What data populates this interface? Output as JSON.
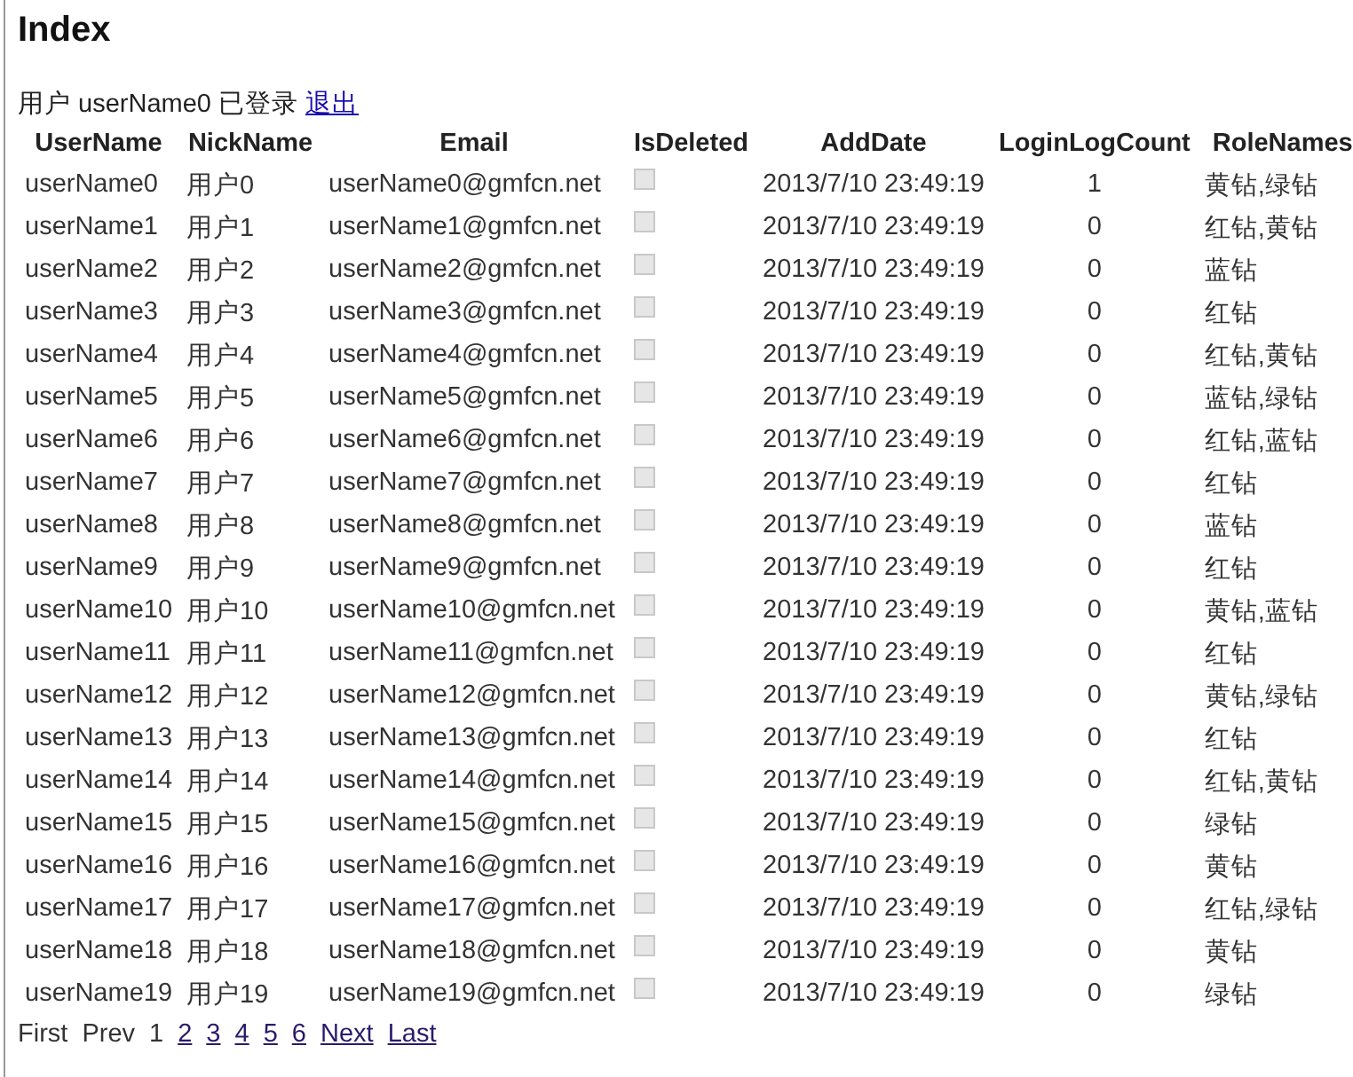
{
  "heading": "Index",
  "login": {
    "text": "用户 userName0 已登录",
    "logout_link": "退出"
  },
  "table": {
    "columns": [
      "UserName",
      "NickName",
      "Email",
      "IsDeleted",
      "AddDate",
      "LoginLogCount",
      "RoleNames"
    ],
    "rows": [
      {
        "username": "userName0",
        "nickname": "用户0",
        "email": "userName0@gmfcn.net",
        "is_deleted": {
          "checked": false,
          "disabled": true
        },
        "add_date": "2013/7/10 23:49:19",
        "login_log_count": "1",
        "role_names": "黄钻,绿钻"
      },
      {
        "username": "userName1",
        "nickname": "用户1",
        "email": "userName1@gmfcn.net",
        "is_deleted": {
          "checked": false,
          "disabled": true
        },
        "add_date": "2013/7/10 23:49:19",
        "login_log_count": "0",
        "role_names": "红钻,黄钻"
      },
      {
        "username": "userName2",
        "nickname": "用户2",
        "email": "userName2@gmfcn.net",
        "is_deleted": {
          "checked": false,
          "disabled": true
        },
        "add_date": "2013/7/10 23:49:19",
        "login_log_count": "0",
        "role_names": "蓝钻"
      },
      {
        "username": "userName3",
        "nickname": "用户3",
        "email": "userName3@gmfcn.net",
        "is_deleted": {
          "checked": false,
          "disabled": true
        },
        "add_date": "2013/7/10 23:49:19",
        "login_log_count": "0",
        "role_names": "红钻"
      },
      {
        "username": "userName4",
        "nickname": "用户4",
        "email": "userName4@gmfcn.net",
        "is_deleted": {
          "checked": false,
          "disabled": true
        },
        "add_date": "2013/7/10 23:49:19",
        "login_log_count": "0",
        "role_names": "红钻,黄钻"
      },
      {
        "username": "userName5",
        "nickname": "用户5",
        "email": "userName5@gmfcn.net",
        "is_deleted": {
          "checked": false,
          "disabled": true
        },
        "add_date": "2013/7/10 23:49:19",
        "login_log_count": "0",
        "role_names": "蓝钻,绿钻"
      },
      {
        "username": "userName6",
        "nickname": "用户6",
        "email": "userName6@gmfcn.net",
        "is_deleted": {
          "checked": false,
          "disabled": true
        },
        "add_date": "2013/7/10 23:49:19",
        "login_log_count": "0",
        "role_names": "红钻,蓝钻"
      },
      {
        "username": "userName7",
        "nickname": "用户7",
        "email": "userName7@gmfcn.net",
        "is_deleted": {
          "checked": false,
          "disabled": true
        },
        "add_date": "2013/7/10 23:49:19",
        "login_log_count": "0",
        "role_names": "红钻"
      },
      {
        "username": "userName8",
        "nickname": "用户8",
        "email": "userName8@gmfcn.net",
        "is_deleted": {
          "checked": false,
          "disabled": true
        },
        "add_date": "2013/7/10 23:49:19",
        "login_log_count": "0",
        "role_names": "蓝钻"
      },
      {
        "username": "userName9",
        "nickname": "用户9",
        "email": "userName9@gmfcn.net",
        "is_deleted": {
          "checked": false,
          "disabled": true
        },
        "add_date": "2013/7/10 23:49:19",
        "login_log_count": "0",
        "role_names": "红钻"
      },
      {
        "username": "userName10",
        "nickname": "用户10",
        "email": "userName10@gmfcn.net",
        "is_deleted": {
          "checked": false,
          "disabled": true
        },
        "add_date": "2013/7/10 23:49:19",
        "login_log_count": "0",
        "role_names": "黄钻,蓝钻"
      },
      {
        "username": "userName11",
        "nickname": "用户11",
        "email": "userName11@gmfcn.net",
        "is_deleted": {
          "checked": false,
          "disabled": true
        },
        "add_date": "2013/7/10 23:49:19",
        "login_log_count": "0",
        "role_names": "红钻"
      },
      {
        "username": "userName12",
        "nickname": "用户12",
        "email": "userName12@gmfcn.net",
        "is_deleted": {
          "checked": false,
          "disabled": true
        },
        "add_date": "2013/7/10 23:49:19",
        "login_log_count": "0",
        "role_names": "黄钻,绿钻"
      },
      {
        "username": "userName13",
        "nickname": "用户13",
        "email": "userName13@gmfcn.net",
        "is_deleted": {
          "checked": false,
          "disabled": true
        },
        "add_date": "2013/7/10 23:49:19",
        "login_log_count": "0",
        "role_names": "红钻"
      },
      {
        "username": "userName14",
        "nickname": "用户14",
        "email": "userName14@gmfcn.net",
        "is_deleted": {
          "checked": false,
          "disabled": true
        },
        "add_date": "2013/7/10 23:49:19",
        "login_log_count": "0",
        "role_names": "红钻,黄钻"
      },
      {
        "username": "userName15",
        "nickname": "用户15",
        "email": "userName15@gmfcn.net",
        "is_deleted": {
          "checked": false,
          "disabled": true
        },
        "add_date": "2013/7/10 23:49:19",
        "login_log_count": "0",
        "role_names": "绿钻"
      },
      {
        "username": "userName16",
        "nickname": "用户16",
        "email": "userName16@gmfcn.net",
        "is_deleted": {
          "checked": false,
          "disabled": true
        },
        "add_date": "2013/7/10 23:49:19",
        "login_log_count": "0",
        "role_names": "黄钻"
      },
      {
        "username": "userName17",
        "nickname": "用户17",
        "email": "userName17@gmfcn.net",
        "is_deleted": {
          "checked": false,
          "disabled": true
        },
        "add_date": "2013/7/10 23:49:19",
        "login_log_count": "0",
        "role_names": "红钻,绿钻"
      },
      {
        "username": "userName18",
        "nickname": "用户18",
        "email": "userName18@gmfcn.net",
        "is_deleted": {
          "checked": false,
          "disabled": true
        },
        "add_date": "2013/7/10 23:49:19",
        "login_log_count": "0",
        "role_names": "黄钻"
      },
      {
        "username": "userName19",
        "nickname": "用户19",
        "email": "userName19@gmfcn.net",
        "is_deleted": {
          "checked": false,
          "disabled": true
        },
        "add_date": "2013/7/10 23:49:19",
        "login_log_count": "0",
        "role_names": "绿钻"
      }
    ]
  },
  "pager": [
    {
      "label": "First",
      "kind": "text"
    },
    {
      "label": "Prev",
      "kind": "text"
    },
    {
      "label": "1",
      "kind": "text"
    },
    {
      "label": "2",
      "kind": "link"
    },
    {
      "label": "3",
      "kind": "link"
    },
    {
      "label": "4",
      "kind": "link"
    },
    {
      "label": "5",
      "kind": "link"
    },
    {
      "label": "6",
      "kind": "link"
    },
    {
      "label": "Next",
      "kind": "link"
    },
    {
      "label": "Last",
      "kind": "link"
    }
  ]
}
